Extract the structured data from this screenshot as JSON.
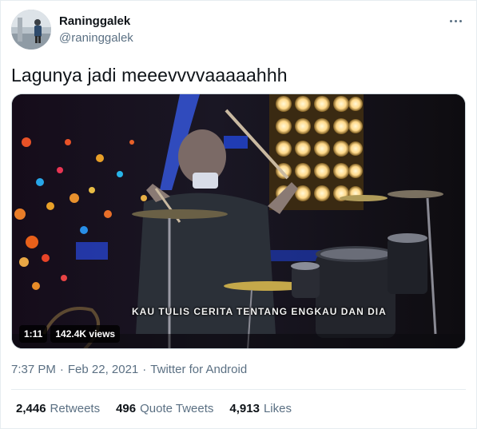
{
  "author": {
    "name": "Raninggalek",
    "handle": "@raninggalek"
  },
  "tweet": {
    "text": "Lagunya jadi meeevvvvaaaaahhh"
  },
  "video": {
    "subtitle": "KAU TULIS CERITA TENTANG ENGKAU DAN DIA",
    "duration": "1:11",
    "views": "142.4K views"
  },
  "meta": {
    "time": "7:37 PM",
    "separator1": "·",
    "date": "Feb 22, 2021",
    "separator2": "·",
    "source": "Twitter for Android"
  },
  "stats": [
    {
      "count": "2,446",
      "label": "Retweets"
    },
    {
      "count": "496",
      "label": "Quote Tweets"
    },
    {
      "count": "4,913",
      "label": "Likes"
    }
  ],
  "icons": {
    "more": "more-horizontal-icon"
  },
  "colors": {
    "primary_text": "#0f1419",
    "secondary_text": "#5b7083",
    "border": "#e6ecf0"
  }
}
